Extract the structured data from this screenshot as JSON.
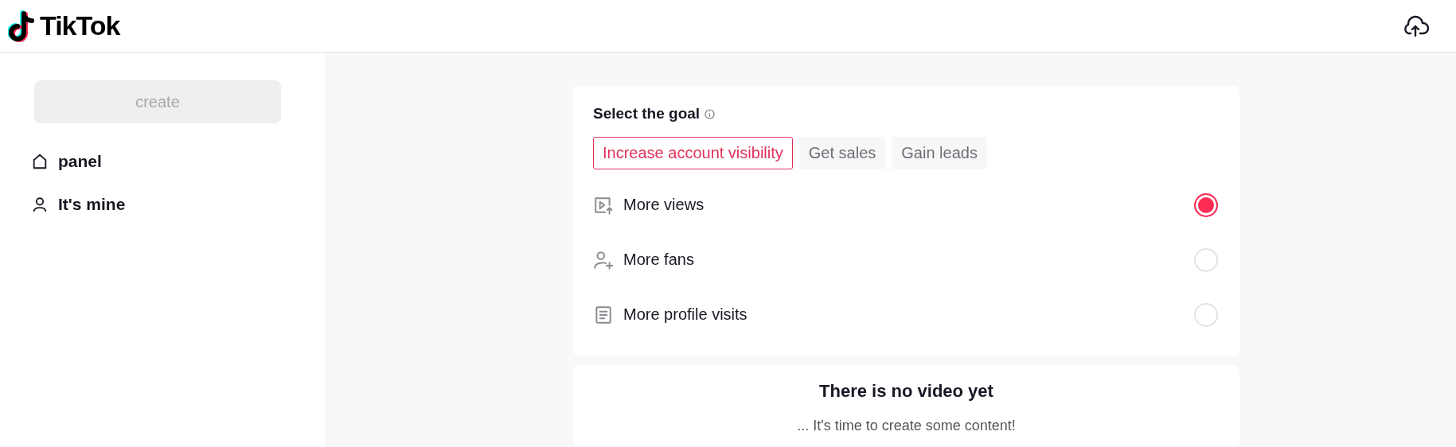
{
  "header": {
    "logo_text": "TikTok"
  },
  "sidebar": {
    "create_button": {
      "label": "create",
      "disabled": true
    },
    "items": [
      {
        "kind": "home",
        "label": "panel"
      },
      {
        "kind": "person",
        "label": "It's mine"
      }
    ]
  },
  "goal_card": {
    "title": "Select the goal",
    "tabs": [
      {
        "label": "Increase account visibility",
        "selected": true
      },
      {
        "label": "Get sales",
        "selected": false
      },
      {
        "label": "Gain leads",
        "selected": false
      }
    ],
    "options": [
      {
        "kind": "video",
        "label": "More views",
        "selected": true
      },
      {
        "kind": "fans",
        "label": "More fans",
        "selected": false
      },
      {
        "kind": "profile",
        "label": "More profile visits",
        "selected": false
      }
    ]
  },
  "empty_card": {
    "title": "There is no video yet",
    "message": "... It's time to create some content!"
  }
}
